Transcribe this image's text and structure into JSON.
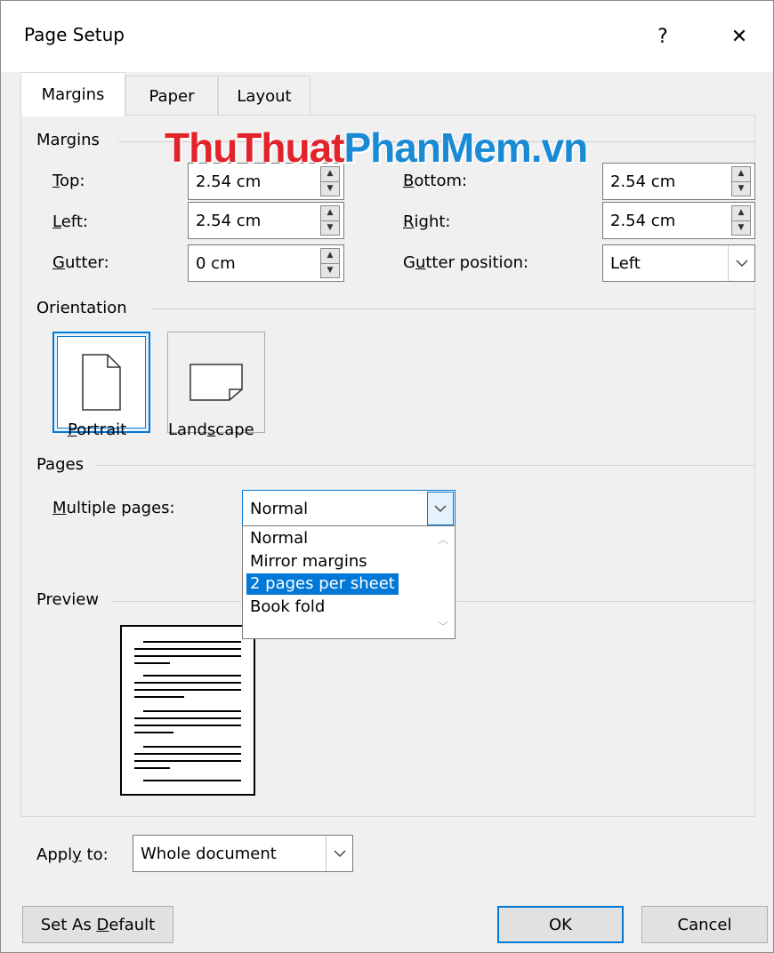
{
  "window": {
    "title": "Page Setup",
    "help": "?",
    "close": "✕"
  },
  "tabs": [
    {
      "label": "Margins",
      "active": true
    },
    {
      "label": "Paper",
      "active": false
    },
    {
      "label": "Layout",
      "active": false
    }
  ],
  "margins": {
    "group": "Margins",
    "top": {
      "label_pre": "",
      "label_u": "T",
      "label_post": "op:",
      "value": "2.54 cm"
    },
    "bottom": {
      "label_pre": "",
      "label_u": "B",
      "label_post": "ottom:",
      "value": "2.54 cm"
    },
    "left": {
      "label_pre": "",
      "label_u": "L",
      "label_post": "eft:",
      "value": "2.54 cm"
    },
    "right": {
      "label_pre": "",
      "label_u": "R",
      "label_post": "ight:",
      "value": "2.54 cm"
    },
    "gutter": {
      "label_pre": "",
      "label_u": "G",
      "label_post": "utter:",
      "value": "0 cm"
    },
    "gutter_position": {
      "label_pre": "G",
      "label_u": "u",
      "label_post": "tter position:",
      "value": "Left"
    }
  },
  "orientation": {
    "group": "Orientation",
    "portrait": {
      "pre": "",
      "u": "P",
      "post": "ortrait"
    },
    "landscape": {
      "pre": "Land",
      "u": "s",
      "post": "cape"
    }
  },
  "pages": {
    "group": "Pages",
    "multiple_label_u": "M",
    "multiple_label_rest": "ultiple pages:",
    "selected": "Normal",
    "options": [
      "Normal",
      "Mirror margins",
      "2 pages per sheet",
      "Book fold"
    ],
    "highlighted": "2 pages per sheet"
  },
  "preview": {
    "group": "Preview"
  },
  "apply_to": {
    "label_pre": "Appl",
    "label_u": "y",
    "label_post": " to:",
    "value": "Whole document"
  },
  "buttons": {
    "set_default_pre": "Set As ",
    "set_default_u": "D",
    "set_default_post": "efault",
    "ok": "OK",
    "cancel": "Cancel"
  },
  "watermark": {
    "part1": "ThuThuat",
    "part2": "PhanMem.vn"
  },
  "colors": {
    "accent": "#0078d7",
    "watermark_red": "#e2232a",
    "watermark_blue": "#1a8ad4"
  }
}
